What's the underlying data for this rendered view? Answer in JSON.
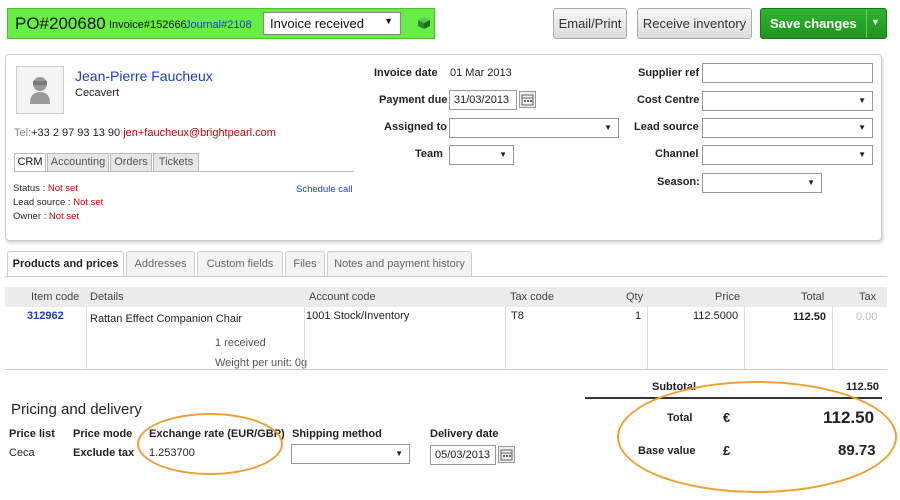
{
  "header": {
    "po_number": "PO#200680",
    "invoice_ref": "Invoice#152666",
    "journal_ref": "Journal#2108",
    "status": "Invoice received",
    "email_print_label": "Email/Print",
    "receive_inventory_label": "Receive inventory",
    "save_label": "Save changes",
    "accent_color": "#66ee44",
    "save_color": "#1f941f"
  },
  "contact": {
    "name": "Jean-Pierre Faucheux",
    "company": "Cecavert",
    "tel_prefix": "Tel:",
    "tel": "+33 2 97 93 13 90",
    "email": "jen+faucheux@brightpearl.com",
    "tabs": [
      "CRM",
      "Accounting",
      "Orders",
      "Tickets"
    ],
    "crm": {
      "status_label": "Status :",
      "status_value": "Not set",
      "lead_label": "Lead source :",
      "lead_value": "Not set",
      "owner_label": "Owner :",
      "owner_value": "Not set",
      "schedule_call": "Schedule call"
    }
  },
  "form": {
    "invoice_date_label": "Invoice date",
    "invoice_date": "01 Mar 2013",
    "payment_due_label": "Payment due",
    "payment_due": "31/03/2013",
    "assigned_to_label": "Assigned to",
    "team_label": "Team",
    "supplier_ref_label": "Supplier ref",
    "cost_centre_label": "Cost Centre",
    "lead_source_label": "Lead source",
    "channel_label": "Channel",
    "season_label": "Season:"
  },
  "tabs": [
    "Products and prices",
    "Addresses",
    "Custom fields",
    "Files",
    "Notes and payment history"
  ],
  "table": {
    "columns": [
      "Item code",
      "Details",
      "Account code",
      "Tax code",
      "Qty",
      "Price",
      "Total",
      "Tax"
    ],
    "rows": [
      {
        "item_code": "312962",
        "details": "Rattan Effect Companion Chair",
        "received": "1 received",
        "weight": "Weight per unit: 0g",
        "account_code": "1001 Stock/Inventory",
        "tax_code": "T8",
        "qty": "1",
        "price": "112.5000",
        "total": "112.50",
        "tax": "0.00"
      }
    ]
  },
  "pricing": {
    "title": "Pricing and delivery",
    "price_list_label": "Price list",
    "price_list": "Ceca",
    "price_mode_label": "Price mode",
    "price_mode": "Exclude tax",
    "exchange_rate_label": "Exchange rate (EUR/GBP)",
    "exchange_rate": "1.253700",
    "shipping_method_label": "Shipping method",
    "delivery_date_label": "Delivery date",
    "delivery_date": "05/03/2013"
  },
  "totals": {
    "subtotal_label": "Subtotal",
    "subtotal": "112.50",
    "total_label": "Total",
    "total_currency": "€",
    "total": "112.50",
    "base_label": "Base value",
    "base_currency": "£",
    "base": "89.73"
  }
}
